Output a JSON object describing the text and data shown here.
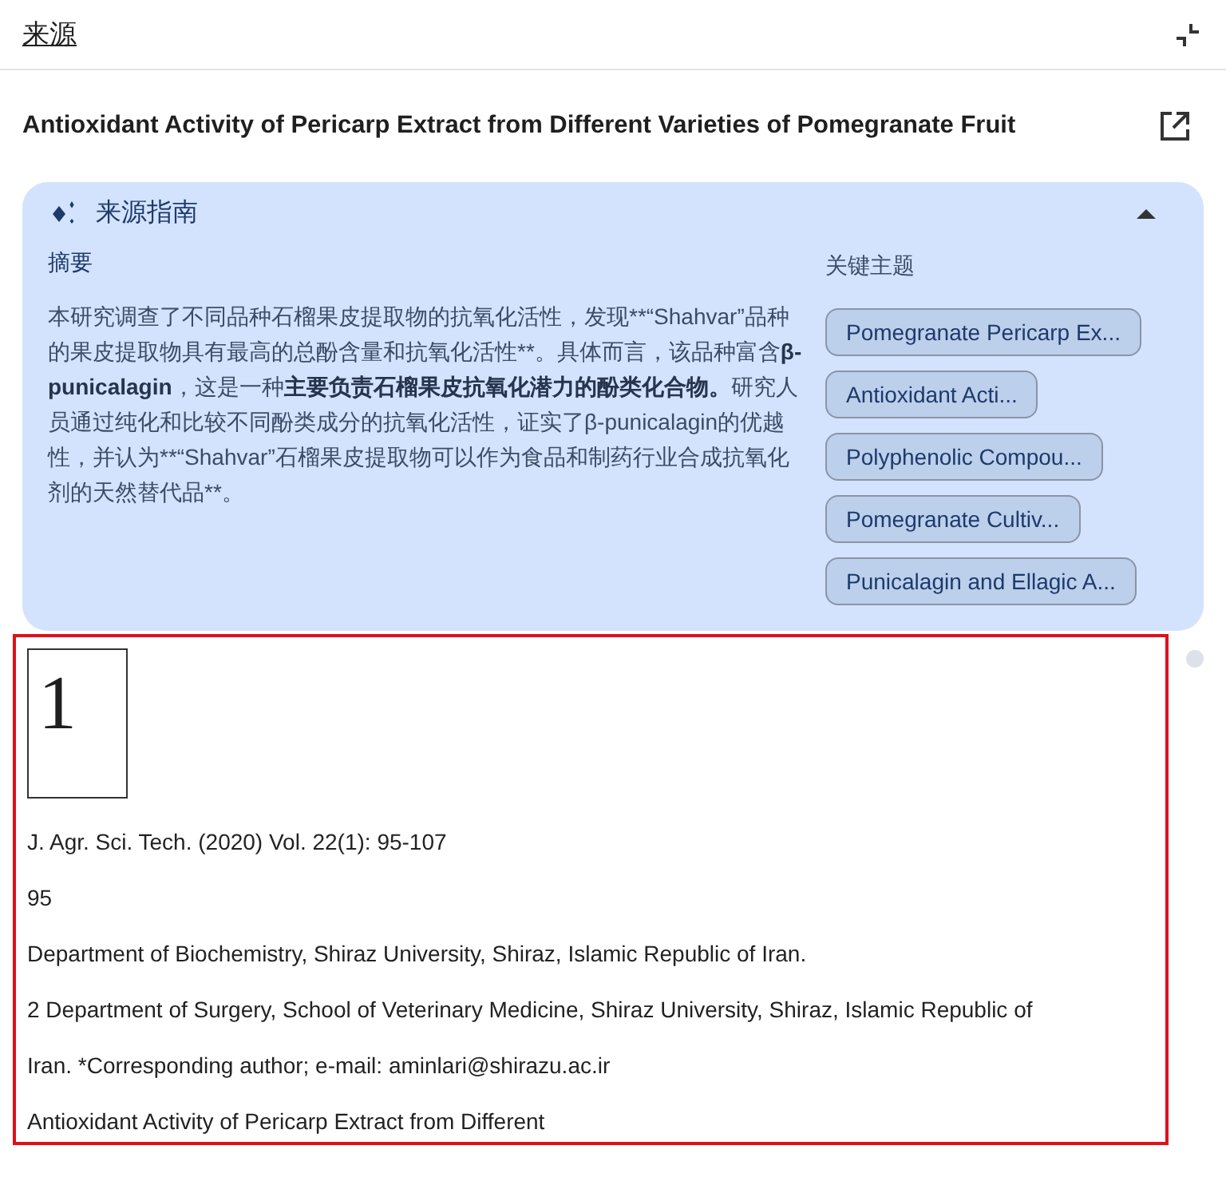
{
  "header": {
    "title": "来源"
  },
  "source": {
    "title": "Antioxidant Activity of Pericarp Extract from Different Varieties of Pomegranate Fruit"
  },
  "guide": {
    "title": "来源指南",
    "expanded": true,
    "summary_heading": "摘要",
    "summary": [
      {
        "text": "本研究调查了不同品种石榴果皮提取物的抗氧化活性，发现**“Shahvar”品种的果皮提取物具有最高的总酚含量和抗氧化活性**。具体而言，该品种富含",
        "bold": false
      },
      {
        "text": "β-punicalagin",
        "bold": true
      },
      {
        "text": "，这是一种",
        "bold": false
      },
      {
        "text": "主要负责石榴果皮抗氧化潜力的酚类化合物。",
        "bold": true
      },
      {
        "text": "研究人员通过纯化和比较不同酚类成分的抗氧化活性，证实了β-punicalagin的优越性，并认为**“Shahvar”石榴果皮提取物可以作为食品和制药行业合成抗氧化剂的天然替代品**。",
        "bold": false
      }
    ],
    "topics_heading": "关键主题",
    "topics": [
      "Pomegranate Pericarp Ex...",
      "Antioxidant Acti...",
      "Polyphenolic Compou...",
      "Pomegranate Cultiv...",
      "Punicalagin and Ellagic A..."
    ]
  },
  "document": {
    "page_number": "1",
    "lines": [
      "J. Agr. Sci. Tech. (2020) Vol. 22(1): 95-107",
      "95",
      "Department of Biochemistry, Shiraz University, Shiraz, Islamic Republic of Iran.",
      "2 Department of Surgery, School of Veterinary Medicine, Shiraz University, Shiraz, Islamic Republic of",
      "Iran. *Corresponding author; e-mail: aminlari@shirazu.ac.ir",
      "Antioxidant Activity of Pericarp Extract from Different"
    ]
  }
}
